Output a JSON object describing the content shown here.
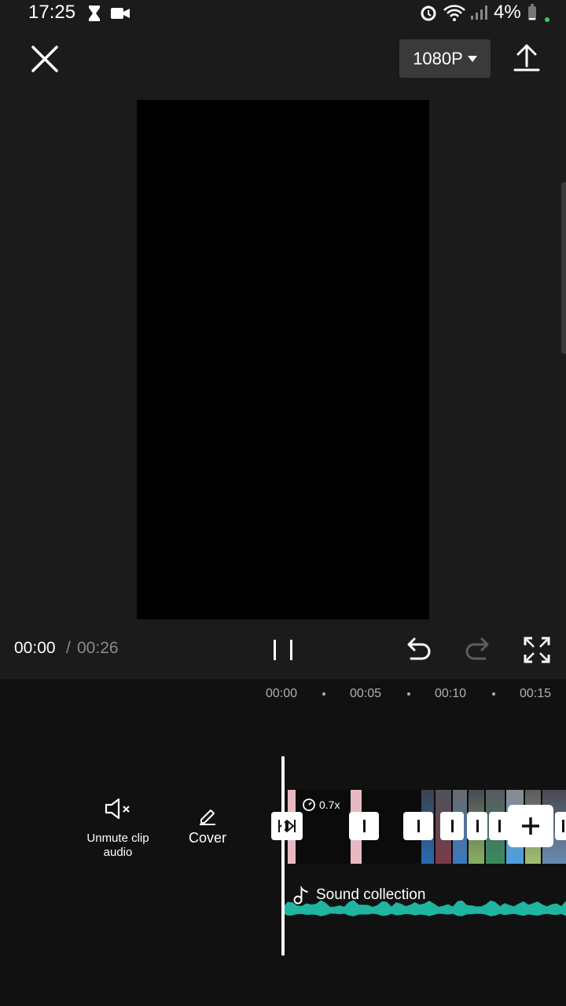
{
  "status_bar": {
    "time": "17:25",
    "battery": "4%",
    "icons": [
      "hourglass-icon",
      "video-camera-icon",
      "alarm-icon",
      "wifi-icon",
      "signal-icon",
      "battery-icon"
    ]
  },
  "top_bar": {
    "resolution": "1080P",
    "icons": [
      "close-icon",
      "caret-down-icon",
      "export-icon"
    ]
  },
  "playback": {
    "current_time": "00:00",
    "separator": "/",
    "total_time": "00:26",
    "icons": [
      "pause-icon",
      "undo-icon",
      "redo-icon",
      "fullscreen-icon"
    ]
  },
  "timeline": {
    "ruler": [
      "00:00",
      "00:05",
      "00:10",
      "00:15"
    ],
    "tools": [
      {
        "label": "Unmute clip audio",
        "icon": "speaker-mute-icon"
      },
      {
        "label": "Cover",
        "icon": "pencil-icon"
      }
    ],
    "clip_speed": "0.7x",
    "audio_track_label": "Sound collection",
    "colors": {
      "waveform": "#1fb5a0",
      "clip_pink": "#e8b9c2"
    }
  }
}
